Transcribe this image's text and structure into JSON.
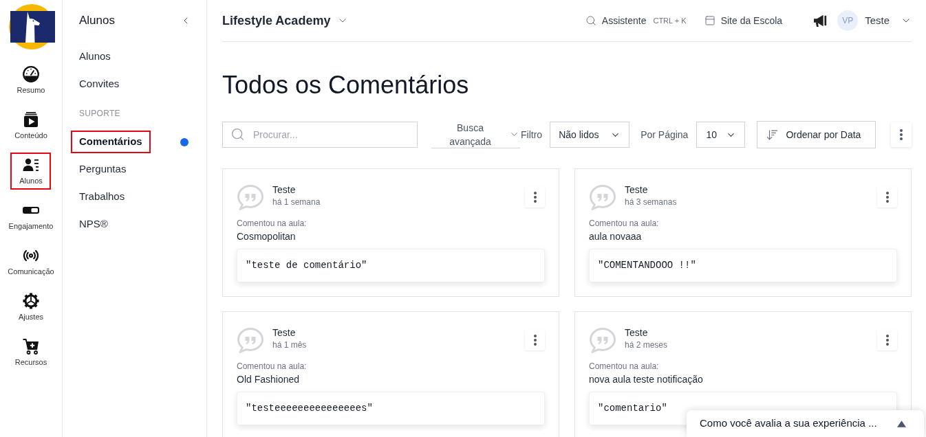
{
  "rail": {
    "items": [
      {
        "kind": "gauge",
        "label": "Resumo",
        "highlighted": false
      },
      {
        "kind": "play",
        "label": "Conteúdo",
        "highlighted": false
      },
      {
        "kind": "people",
        "label": "Alunos",
        "highlighted": true
      },
      {
        "kind": "toggle",
        "label": "Engajamento",
        "highlighted": false
      },
      {
        "kind": "broadcast",
        "label": "Comunicação",
        "highlighted": false
      },
      {
        "kind": "gear",
        "label": "Ajustes",
        "highlighted": false
      },
      {
        "kind": "cart",
        "label": "Recursos",
        "highlighted": false
      }
    ]
  },
  "submenu": {
    "title": "Alunos",
    "items": [
      {
        "kind": "link",
        "label": "Alunos",
        "selected": false,
        "highlighted": false,
        "unread": false
      },
      {
        "kind": "link",
        "label": "Convites",
        "selected": false,
        "highlighted": false,
        "unread": false
      },
      {
        "kind": "section",
        "label": "SUPORTE"
      },
      {
        "kind": "link",
        "label": "Comentários",
        "selected": true,
        "highlighted": true,
        "unread": true
      },
      {
        "kind": "link",
        "label": "Perguntas",
        "selected": false,
        "highlighted": false,
        "unread": false
      },
      {
        "kind": "link",
        "label": "Trabalhos",
        "selected": false,
        "highlighted": false,
        "unread": false
      },
      {
        "kind": "link",
        "label": "NPS®",
        "selected": false,
        "highlighted": false,
        "unread": false
      }
    ]
  },
  "header": {
    "school": "Lifestyle Academy",
    "assistant": {
      "label": "Assistente",
      "shortcut": "CTRL + K"
    },
    "site_link": "Site da Escola",
    "user": {
      "initials": "VP",
      "name": "Teste"
    }
  },
  "page_title": "Todos os Comentários",
  "toolbar": {
    "search": {
      "placeholder": "Procurar..."
    },
    "advanced_search": "Busca avançada",
    "filter": {
      "label": "Filtro",
      "value": "Não lidos"
    },
    "per_page": {
      "label": "Por Página",
      "value": "10"
    },
    "sort_button": "Ordenar por Data"
  },
  "comments": [
    {
      "author": "Teste",
      "time": "há 1 semana",
      "lesson_label": "Comentou na aula:",
      "lesson": "Cosmopolitan",
      "text": "\"teste de comentário\""
    },
    {
      "author": "Teste",
      "time": "há 3 semanas",
      "lesson_label": "Comentou na aula:",
      "lesson": "aula novaaa",
      "text": "\"COMENTANDOOO !!\""
    },
    {
      "author": "Teste",
      "time": "há 1 mês",
      "lesson_label": "Comentou na aula:",
      "lesson": "Old Fashioned",
      "text": "\"testeeeeeeeeeeeeeees\""
    },
    {
      "author": "Teste",
      "time": "há 2 meses",
      "lesson_label": "Comentou na aula:",
      "lesson": "nova aula teste notificação",
      "text": "\"comentario\""
    }
  ],
  "feedback_bar": {
    "text": "Como você avalia a sua experiência ..."
  }
}
